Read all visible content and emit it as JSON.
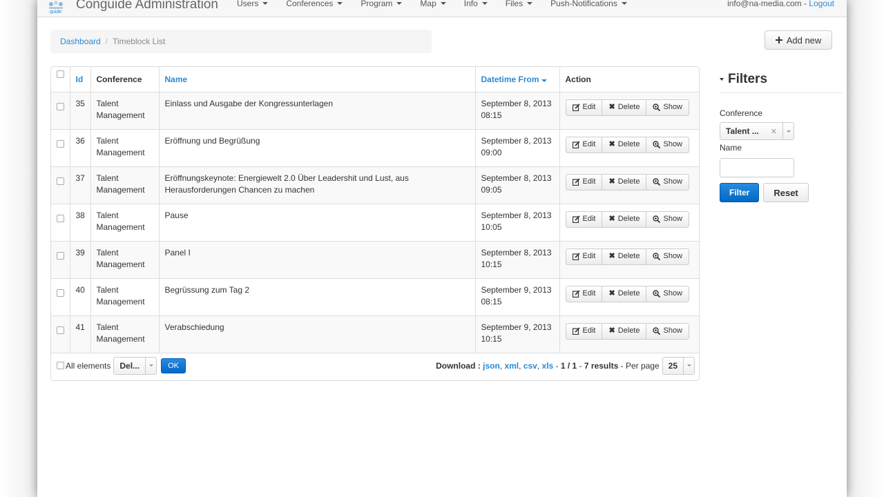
{
  "navbar": {
    "brand": "Conguide Administration",
    "menu": [
      "Users",
      "Conferences",
      "Program",
      "Map",
      "Info",
      "Files",
      "Push-Notifications"
    ],
    "user_email": "info@na-media.com",
    "separator": " - ",
    "logout": "Logout"
  },
  "breadcrumb": {
    "home": "Dashboard",
    "separator": "/",
    "current": "Timeblock List"
  },
  "add_button": "Add new",
  "table": {
    "headers": {
      "id": "Id",
      "conference": "Conference",
      "name": "Name",
      "datetime": "Datetime From",
      "action": "Action"
    },
    "rows": [
      {
        "id": "35",
        "conference": "Talent Management",
        "name": "Einlass und Ausgabe der Kongressunterlagen",
        "date": "September 8, 2013",
        "time": "08:15"
      },
      {
        "id": "36",
        "conference": "Talent Management",
        "name": "Eröffnung und Begrüßung",
        "date": "September 8, 2013",
        "time": "09:00"
      },
      {
        "id": "37",
        "conference": "Talent Management",
        "name": "Eröffnungskeynote: Energiewelt 2.0 Über Leadershit und Lust, aus Herausforderungen Chancen zu machen",
        "date": "September 8, 2013",
        "time": "09:05"
      },
      {
        "id": "38",
        "conference": "Talent Management",
        "name": "Pause",
        "date": "September 8, 2013",
        "time": "10:05"
      },
      {
        "id": "39",
        "conference": "Talent Management",
        "name": "Panel I",
        "date": "September 8, 2013",
        "time": "10:15"
      },
      {
        "id": "40",
        "conference": "Talent Management",
        "name": "Begrüssung zum Tag 2",
        "date": "September 9, 2013",
        "time": "08:15"
      },
      {
        "id": "41",
        "conference": "Talent Management",
        "name": "Verabschiedung",
        "date": "September 9, 2013",
        "time": "10:15"
      }
    ],
    "actions": {
      "edit": "Edit",
      "delete": "Delete",
      "show": "Show"
    }
  },
  "footer": {
    "all_elements": "All elements",
    "batch_action": "Del...",
    "ok": "OK",
    "download_label": "Download :",
    "formats": [
      "json",
      "xml",
      "csv",
      "xls"
    ],
    "pages": "1 / 1",
    "results": "7 results",
    "per_page_label": "Per page",
    "per_page": "25"
  },
  "filters": {
    "title": "Filters",
    "conference_label": "Conference",
    "conference_value": "Talent ...",
    "name_label": "Name",
    "name_value": "",
    "filter_button": "Filter",
    "reset_button": "Reset"
  },
  "colors": {
    "link": "#2a8ad4",
    "primary": "#0068c6"
  }
}
